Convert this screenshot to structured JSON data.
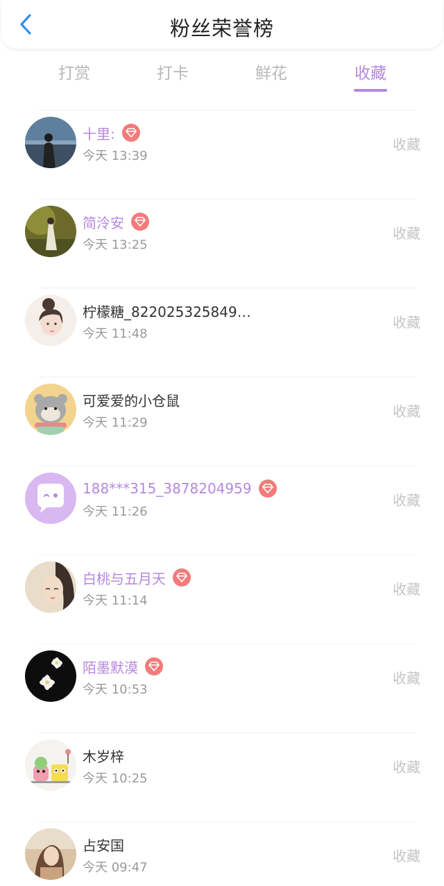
{
  "header": {
    "title": "粉丝荣誉榜",
    "back_icon": "chevron-left-icon",
    "accent": "#2f8ff0"
  },
  "tabs": [
    {
      "label": "打赏",
      "active": false
    },
    {
      "label": "打卡",
      "active": false
    },
    {
      "label": "鲜花",
      "active": false
    },
    {
      "label": "收藏",
      "active": true
    }
  ],
  "colors": {
    "accent": "#b687df",
    "badge": "#f27b7b",
    "muted": "#c4c4c4"
  },
  "fans": [
    {
      "name": "十里:",
      "vip": true,
      "time": "今天 13:39",
      "action": "收藏",
      "avatar": "avatar-city-silhouette"
    },
    {
      "name": "简泠安",
      "vip": true,
      "time": "今天 13:25",
      "action": "收藏",
      "avatar": "avatar-green-field-girl"
    },
    {
      "name": "柠檬糖_822025325849…",
      "vip": false,
      "time": "今天 11:48",
      "action": "收藏",
      "avatar": "avatar-illustrated-girl"
    },
    {
      "name": "可爱爱的小仓鼠",
      "vip": false,
      "time": "今天 11:29",
      "action": "收藏",
      "avatar": "avatar-hamster"
    },
    {
      "name": "188***315_3878204959",
      "vip": true,
      "time": "今天 11:26",
      "action": "收藏",
      "avatar": "avatar-default-chat"
    },
    {
      "name": "白桃与五月天",
      "vip": true,
      "time": "今天 11:14",
      "action": "收藏",
      "avatar": "avatar-painted-girl"
    },
    {
      "name": "陌墨默漠",
      "vip": true,
      "time": "今天 10:53",
      "action": "收藏",
      "avatar": "avatar-white-flowers"
    },
    {
      "name": "木岁梓",
      "vip": false,
      "time": "今天 10:25",
      "action": "收藏",
      "avatar": "avatar-cartoon-characters"
    },
    {
      "name": "占安国",
      "vip": false,
      "time": "今天 09:47",
      "action": "收藏",
      "avatar": "avatar-portrait-girl"
    }
  ]
}
